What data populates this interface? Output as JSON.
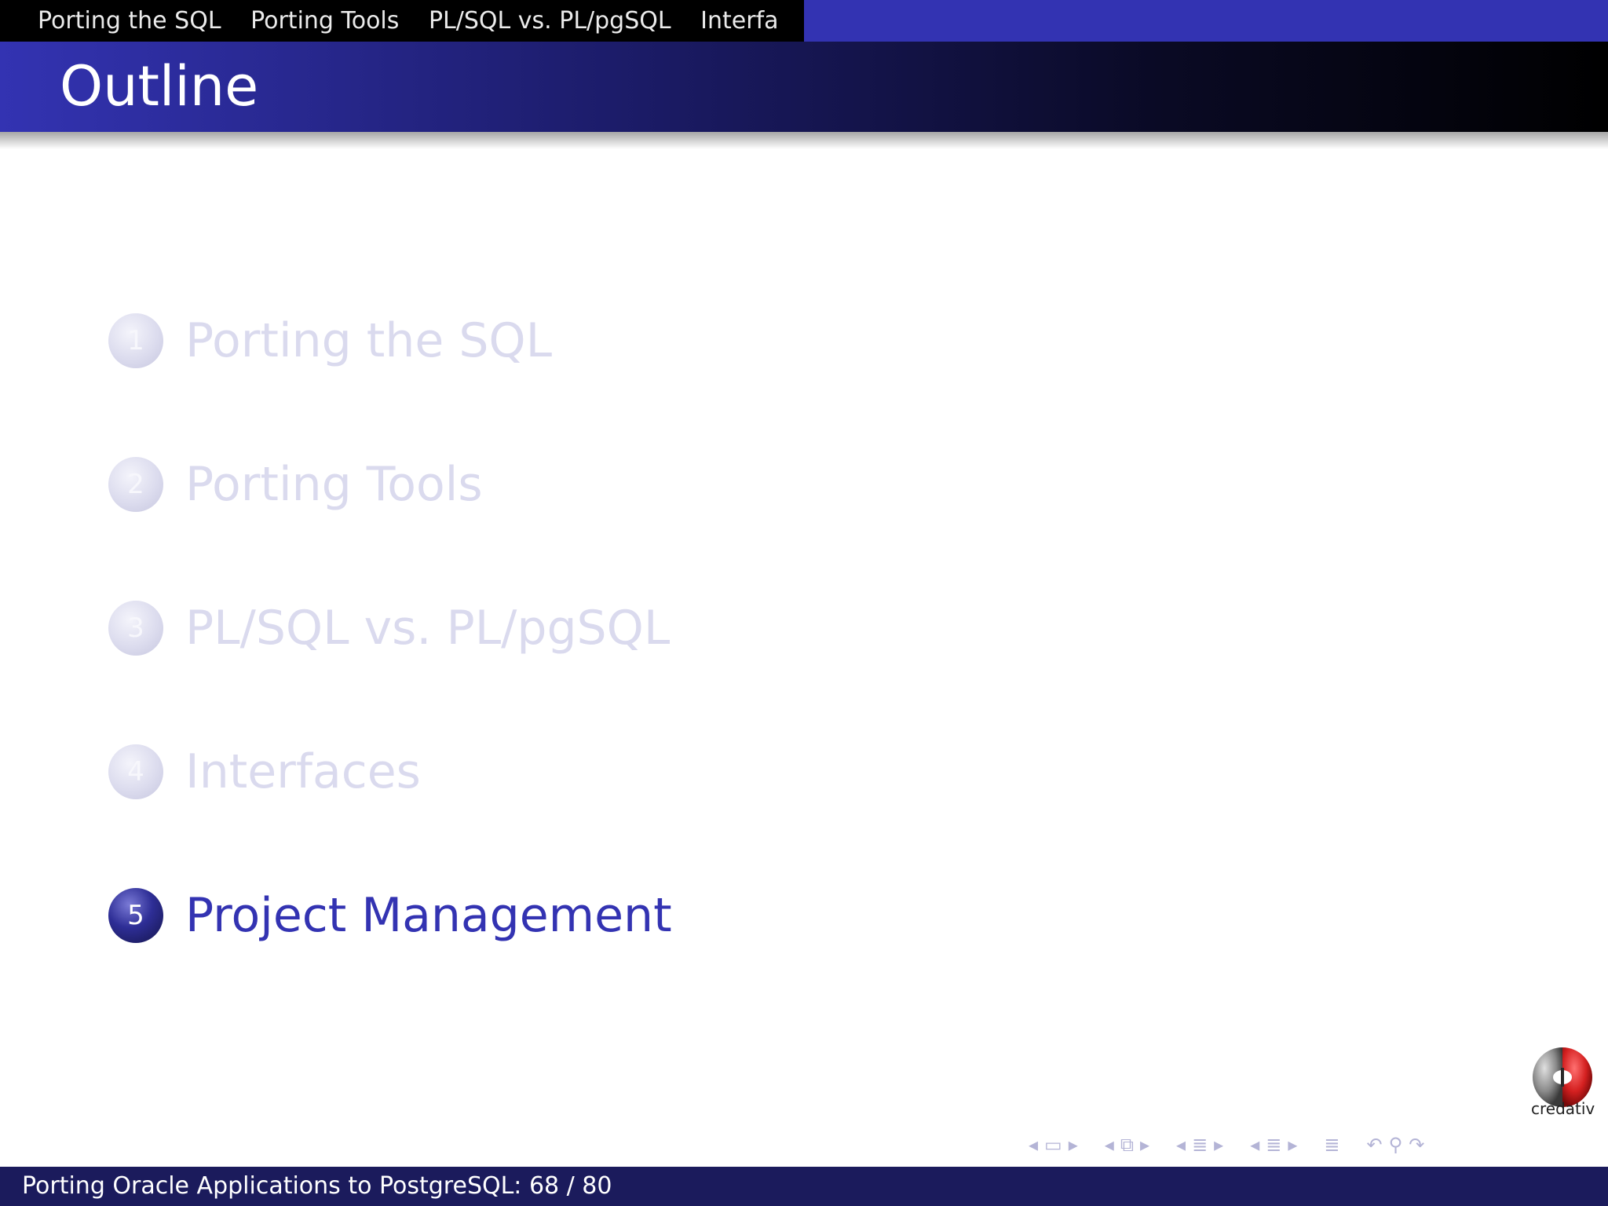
{
  "nav": {
    "sections": [
      "Porting the SQL",
      "Porting Tools",
      "PL/SQL vs. PL/pgSQL",
      "Interfa"
    ]
  },
  "frame": {
    "title": "Outline"
  },
  "outline": {
    "items": [
      {
        "number": "1",
        "label": "Porting the SQL",
        "state": "shaded"
      },
      {
        "number": "2",
        "label": "Porting Tools",
        "state": "shaded"
      },
      {
        "number": "3",
        "label": "PL/SQL vs. PL/pgSQL",
        "state": "shaded"
      },
      {
        "number": "4",
        "label": "Interfaces",
        "state": "shaded"
      },
      {
        "number": "5",
        "label": "Project Management",
        "state": "current"
      }
    ]
  },
  "logo": {
    "text": "credativ"
  },
  "footer": {
    "text": "Porting Oracle Applications to PostgreSQL: 68 / 80"
  },
  "colors": {
    "structure": "#3333b2",
    "footer": "#1b1b5c",
    "logo_red": "#d42020"
  },
  "icons": {
    "nav_symbols": [
      "prev-frame-icon",
      "frame-icon",
      "next-frame-icon",
      "prev-subsection-icon",
      "subsection-icon",
      "next-subsection-icon",
      "prev-section-icon",
      "section-icon",
      "next-section-icon",
      "prev-document-icon",
      "document-icon",
      "next-document-icon",
      "appendix-icon",
      "back-icon",
      "search-icon",
      "forward-icon"
    ]
  }
}
